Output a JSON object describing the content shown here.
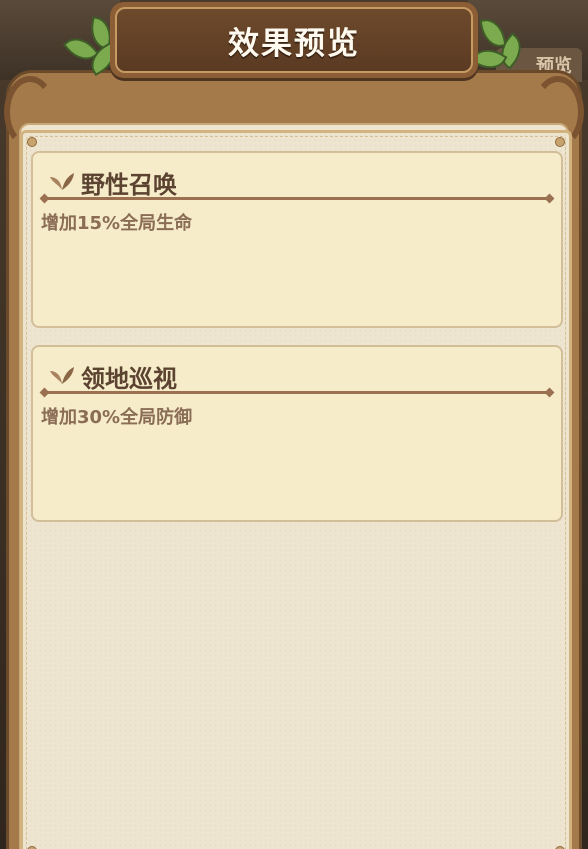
{
  "header": {
    "title": "效果预览",
    "behind_tab_label": "预览"
  },
  "effects": [
    {
      "name": "野性召唤",
      "description": "增加15%全局生命"
    },
    {
      "name": "领地巡视",
      "description": "增加30%全局防御"
    }
  ],
  "colors": {
    "plaque": "#6e4a2c",
    "card_bg": "#f6ecc9",
    "title_text": "#fffaf0",
    "card_title": "#5c4331",
    "card_desc": "#8a6d54",
    "leaf_green": "#7cab4f"
  }
}
